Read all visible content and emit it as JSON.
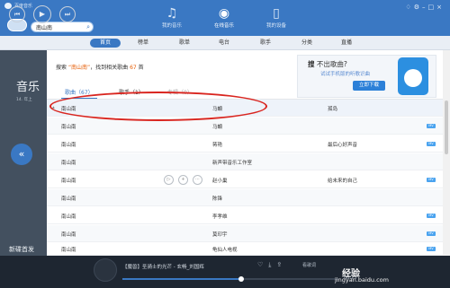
{
  "app": {
    "title": "百度音乐"
  },
  "search": {
    "value": "南山南"
  },
  "nav_tabs": [
    {
      "label": "我的音乐",
      "icon": "music-note-icon"
    },
    {
      "label": "在线音乐",
      "icon": "globe-icon"
    },
    {
      "label": "我的设备",
      "icon": "device-icon"
    }
  ],
  "window_controls": [
    "skin-icon",
    "settings-icon",
    "minimize-icon",
    "maximize-icon",
    "close-icon"
  ],
  "subnav": [
    "首页",
    "榜单",
    "歌单",
    "电台",
    "歌手",
    "分类",
    "直播"
  ],
  "left_panel": {
    "title": "音乐",
    "subtitle": "14. 年上",
    "section_title": "新碟首发"
  },
  "results": {
    "prefix": "搜索",
    "query": "“南山南”",
    "middle": "，找到相关歌曲",
    "count": "67",
    "suffix": "首"
  },
  "tabs": [
    {
      "label": "歌曲（67）"
    },
    {
      "label": "歌手（1）"
    },
    {
      "label": "专辑（0）"
    }
  ],
  "banner": {
    "line1": "不出歌曲?",
    "line2": "试试手机版的听歌识曲",
    "button": "立即下载"
  },
  "songs": [
    {
      "title": "南山南",
      "singer": "马頔",
      "album": "孤岛",
      "badge": ""
    },
    {
      "title": "南山南",
      "singer": "马頔",
      "album": "",
      "badge": "MV"
    },
    {
      "title": "南山南",
      "singer": "蒋艳",
      "album": "最后心好声音",
      "badge": "MV"
    },
    {
      "title": "南山南",
      "singer": "新声带音乐工作室",
      "album": "",
      "badge": ""
    },
    {
      "title": "南山南",
      "singer": "赵小巢",
      "album": "给未来的自己",
      "badge": "MV"
    },
    {
      "title": "南山南",
      "singer": "陈锋",
      "album": "",
      "badge": ""
    },
    {
      "title": "南山南",
      "singer": "李孝维",
      "album": "",
      "badge": "MV"
    },
    {
      "title": "南山南",
      "singer": "莫印宇",
      "album": "",
      "badge": "MV"
    },
    {
      "title": "南山南",
      "singer": "龟仙人电视",
      "album": "",
      "badge": "MV"
    }
  ],
  "player": {
    "now_playing": "【魔兽】圣骑士的光芒 - 玄畅_刘国辉",
    "lyric_button": "看歌词",
    "time": "00:23",
    "progress": 0.55
  },
  "watermark": {
    "brand": "经验",
    "url": "jingyan.baidu.com"
  }
}
